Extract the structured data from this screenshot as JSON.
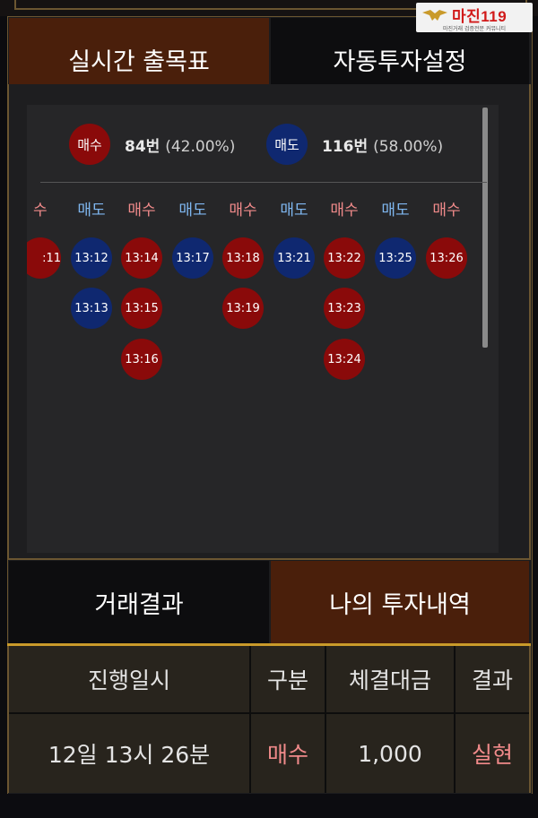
{
  "watermark": {
    "title": "마진119",
    "subtitle": "마진거래 검증전문 커뮤니티"
  },
  "tabs": {
    "realtime": "실시간 출목표",
    "auto_invest": "자동투자설정"
  },
  "summary": {
    "buy_label": "매수",
    "buy_count": "84번",
    "buy_pct": "(42.00%)",
    "sell_label": "매도",
    "sell_count": "116번",
    "sell_pct": "(58.00%)"
  },
  "columns": [
    {
      "header": "수",
      "type": "buy",
      "times": [
        ":11"
      ]
    },
    {
      "header": "매도",
      "type": "sell",
      "times": [
        "13:12",
        "13:13"
      ]
    },
    {
      "header": "매수",
      "type": "buy",
      "times": [
        "13:14",
        "13:15",
        "13:16"
      ]
    },
    {
      "header": "매도",
      "type": "sell",
      "times": [
        "13:17"
      ]
    },
    {
      "header": "매수",
      "type": "buy",
      "times": [
        "13:18",
        "13:19"
      ]
    },
    {
      "header": "매도",
      "type": "sell",
      "times": [
        "13:21"
      ]
    },
    {
      "header": "매수",
      "type": "buy",
      "times": [
        "13:22",
        "13:23",
        "13:24"
      ]
    },
    {
      "header": "매도",
      "type": "sell",
      "times": [
        "13:25"
      ]
    },
    {
      "header": "매수",
      "type": "buy",
      "times": [
        "13:26"
      ]
    }
  ],
  "bottom_tabs": {
    "trade_result": "거래결과",
    "my_history": "나의 투자내역"
  },
  "table": {
    "headers": [
      "진행일시",
      "구분",
      "체결대금",
      "결과"
    ],
    "rows": [
      [
        "12일 13시 26분",
        "매수",
        "1,000",
        "실현"
      ]
    ]
  },
  "colors": {
    "buy": "#8a0a0a",
    "sell": "#0f2870",
    "buy_text": "#f08a8a",
    "sell_text": "#7fb7f0",
    "active_tab": "#4a1f0b",
    "gold": "#c99a2a"
  }
}
